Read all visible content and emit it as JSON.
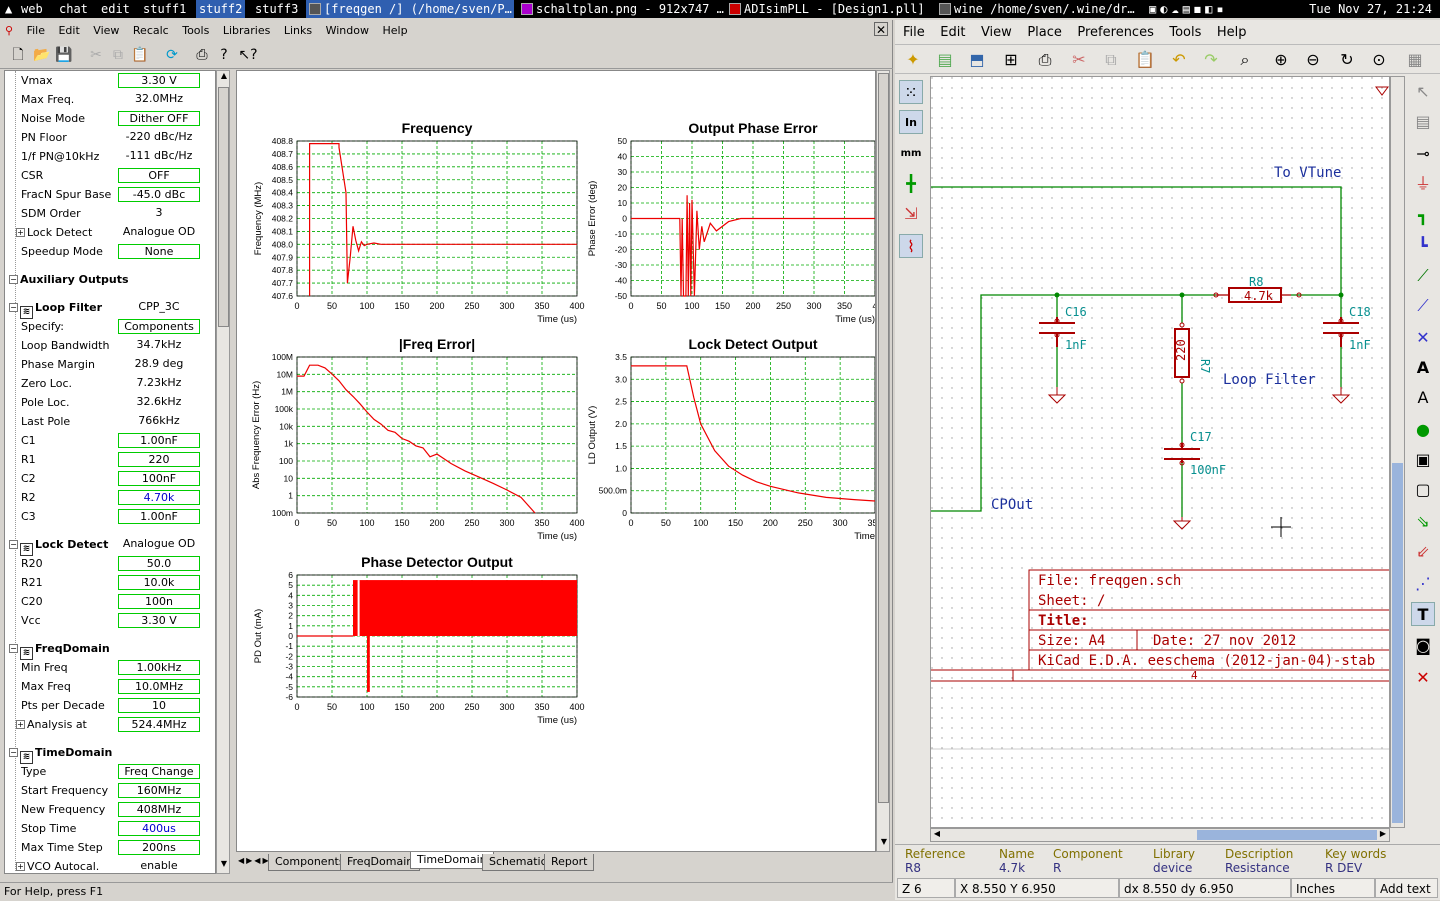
{
  "taskbar": {
    "items": [
      "web",
      "chat",
      "edit",
      "stuff1",
      "stuff2",
      "stuff3"
    ],
    "windows": [
      "[freqgen /] (/home/sven/P…",
      "schaltplan.png - 912x747 …",
      "ADIsimPLL - [Design1.pll]",
      "wine /home/sven/.wine/dr…"
    ],
    "clock": "Tue Nov 27, 21:24"
  },
  "adi": {
    "menu": [
      "File",
      "Edit",
      "View",
      "Recalc",
      "Tools",
      "Libraries",
      "Links",
      "Window",
      "Help"
    ],
    "tree": [
      {
        "label": "Vmax",
        "value": "3.30 V",
        "box": true
      },
      {
        "label": "Max Freq.",
        "value": "32.0MHz"
      },
      {
        "label": "Noise Mode",
        "value": "Dither OFF",
        "box": true
      },
      {
        "label": "PN Floor",
        "value": "-220 dBc/Hz"
      },
      {
        "label": "1/f PN@10kHz",
        "value": "-111 dBc/Hz"
      },
      {
        "label": "CSR",
        "value": "OFF",
        "box": true
      },
      {
        "label": "FracN Spur Base",
        "value": "-45.0 dBc",
        "box": true
      },
      {
        "label": "SDM Order",
        "value": "3"
      },
      {
        "label": "Lock Detect",
        "value": "Analogue OD",
        "exp": true
      },
      {
        "label": "Speedup Mode",
        "value": "None",
        "box": true
      },
      {
        "gap": true
      },
      {
        "label": "Auxiliary Outputs",
        "section": true
      },
      {
        "gap": true
      },
      {
        "label": "Loop Filter",
        "value": "CPP_3C",
        "section": true,
        "icon": true
      },
      {
        "label": "Specify:",
        "value": "Components",
        "box": true
      },
      {
        "label": "Loop Bandwidth",
        "value": "34.7kHz"
      },
      {
        "label": "Phase Margin",
        "value": "28.9 deg"
      },
      {
        "label": "Zero Loc.",
        "value": "7.23kHz"
      },
      {
        "label": "Pole Loc.",
        "value": "32.6kHz"
      },
      {
        "label": "Last Pole",
        "value": "766kHz"
      },
      {
        "label": "C1",
        "value": "1.00nF",
        "box": true
      },
      {
        "label": "R1",
        "value": "220",
        "box": true
      },
      {
        "label": "C2",
        "value": "100nF",
        "box": true
      },
      {
        "label": "R2",
        "value": "4.70k",
        "box": true,
        "blue": true
      },
      {
        "label": "C3",
        "value": "1.00nF",
        "box": true
      },
      {
        "gap": true
      },
      {
        "label": "Lock Detect",
        "value": "Analogue OD",
        "section": true,
        "icon": true
      },
      {
        "label": "R20",
        "value": "50.0",
        "box": true
      },
      {
        "label": "R21",
        "value": "10.0k",
        "box": true
      },
      {
        "label": "C20",
        "value": "100n",
        "box": true
      },
      {
        "label": "Vcc",
        "value": "3.30 V",
        "box": true
      },
      {
        "gap": true
      },
      {
        "label": "FreqDomain",
        "section": true,
        "icon": true
      },
      {
        "label": "Min Freq",
        "value": "1.00kHz",
        "box": true
      },
      {
        "label": "Max Freq",
        "value": "10.0MHz",
        "box": true
      },
      {
        "label": "Pts per Decade",
        "value": "10",
        "box": true
      },
      {
        "label": "Analysis at",
        "value": "524.4MHz",
        "box": true,
        "exp": true
      },
      {
        "gap": true
      },
      {
        "label": "TimeDomain",
        "section": true,
        "icon": true
      },
      {
        "label": "Type",
        "value": "Freq Change",
        "box": true
      },
      {
        "label": "Start Frequency",
        "value": "160MHz",
        "box": true
      },
      {
        "label": "New Frequency",
        "value": "408MHz",
        "box": true
      },
      {
        "label": "Stop Time",
        "value": "400us",
        "box": true,
        "blue": true
      },
      {
        "label": "Max Time Step",
        "value": "200ns",
        "box": true
      },
      {
        "label": "VCO Autocal.",
        "value": "enable",
        "exp": true
      }
    ],
    "tabs": [
      "Components",
      "FreqDomain",
      "TimeDomain",
      "Schematic",
      "Report"
    ],
    "active_tab": "TimeDomain",
    "status": "For Help, press F1"
  },
  "chart_data": [
    {
      "type": "line",
      "title": "Frequency",
      "xlabel": "Time (us)",
      "ylabel": "Frequency (MHz)",
      "xlim": [
        0,
        400
      ],
      "ylim": [
        407.6,
        408.8
      ],
      "xticks": [
        "0",
        "50",
        "100",
        "150",
        "200",
        "250",
        "300",
        "350",
        "400"
      ],
      "yticks": [
        "407.6",
        "407.7",
        "407.8",
        "407.9",
        "408.0",
        "408.1",
        "408.2",
        "408.3",
        "408.4",
        "408.5",
        "408.6",
        "408.7",
        "408.8"
      ],
      "x": [
        18,
        18,
        60,
        60,
        70,
        72,
        76,
        80,
        84,
        88,
        92,
        96,
        100,
        110,
        120,
        140,
        160,
        200,
        400
      ],
      "y": [
        407.6,
        408.78,
        408.78,
        408.75,
        408.4,
        407.7,
        407.9,
        408.14,
        408.03,
        407.95,
        408.02,
        407.99,
        408.0,
        408.01,
        408.0,
        408.0,
        408.0,
        408.0,
        408.0
      ]
    },
    {
      "type": "line",
      "title": "Output Phase Error",
      "xlabel": "Time (us)",
      "ylabel": "Phase Error (deg)",
      "xlim": [
        0,
        400
      ],
      "ylim": [
        -50,
        50
      ],
      "xticks": [
        "0",
        "50",
        "100",
        "150",
        "200",
        "250",
        "300",
        "350",
        "4"
      ],
      "yticks": [
        "-50",
        "-40",
        "-30",
        "-20",
        "-10",
        "0",
        "10",
        "20",
        "30",
        "40",
        "50"
      ],
      "x": [
        0,
        80,
        82,
        84,
        86,
        90,
        92,
        94,
        96,
        98,
        100,
        104,
        108,
        112,
        116,
        120,
        130,
        140,
        160,
        180,
        200,
        400
      ],
      "y": [
        0,
        0,
        -50,
        0,
        -50,
        -50,
        15,
        -50,
        10,
        -50,
        12,
        -50,
        5,
        -20,
        -5,
        -15,
        -3,
        -8,
        -2,
        0,
        0,
        0
      ]
    },
    {
      "type": "line",
      "title": "|Freq Error|",
      "xlabel": "Time (us)",
      "ylabel": "Abs Frequency Error (Hz)",
      "xlim": [
        0,
        400
      ],
      "ylim": [
        0.01,
        100000000
      ],
      "yscale": "log",
      "xticks": [
        "0",
        "50",
        "100",
        "150",
        "200",
        "250",
        "300",
        "350",
        "400"
      ],
      "yticks": [
        "100m",
        "1",
        "10",
        "100",
        "1k",
        "10k",
        "100k",
        "1M",
        "10M",
        "100M"
      ],
      "x": [
        0,
        10,
        18,
        30,
        40,
        50,
        60,
        70,
        80,
        90,
        100,
        110,
        120,
        130,
        140,
        150,
        160,
        170,
        180,
        190,
        200,
        210,
        220,
        240,
        260,
        280,
        300,
        320,
        340
      ],
      "y": [
        6000000,
        6000000,
        30000000,
        30000000,
        20000000,
        8000000,
        3000000,
        800000,
        300000,
        100000,
        30000,
        10000,
        5000,
        2000,
        1500,
        600,
        400,
        200,
        150,
        40,
        60,
        30,
        15,
        5,
        2,
        0.8,
        0.3,
        0.1,
        0.01
      ]
    },
    {
      "type": "line",
      "title": "Lock Detect Output",
      "xlabel": "Time",
      "ylabel": "LD Output (V)",
      "xlim": [
        0,
        350
      ],
      "ylim": [
        0,
        3.5
      ],
      "xticks": [
        "0",
        "50",
        "100",
        "150",
        "200",
        "250",
        "300",
        "350"
      ],
      "yticks": [
        "0",
        "500.0m",
        "1.0",
        "1.5",
        "2.0",
        "2.5",
        "3.0",
        "3.5"
      ],
      "x": [
        0,
        80,
        90,
        100,
        120,
        140,
        160,
        180,
        200,
        240,
        280,
        320,
        350
      ],
      "y": [
        3.3,
        3.3,
        2.6,
        2.0,
        1.4,
        1.05,
        0.85,
        0.7,
        0.6,
        0.45,
        0.35,
        0.3,
        0.27
      ]
    },
    {
      "type": "bar",
      "title": "Phase Detector Output",
      "xlabel": "Time (us)",
      "ylabel": "PD Out (mA)",
      "xlim": [
        0,
        400
      ],
      "ylim": [
        -6,
        6
      ],
      "xticks": [
        "0",
        "50",
        "100",
        "150",
        "200",
        "250",
        "300",
        "350",
        "400"
      ],
      "yticks": [
        "-6",
        "-5",
        "-4",
        "-3",
        "-2",
        "-1",
        "0",
        "1",
        "2",
        "3",
        "4",
        "5",
        "6"
      ],
      "segments": [
        {
          "x0": 80,
          "x1": 400,
          "lo": 0,
          "hi": 5.5
        },
        {
          "x0": 100,
          "x1": 104,
          "lo": -5.5,
          "hi": 0
        }
      ]
    }
  ],
  "kicad": {
    "menu": [
      "File",
      "Edit",
      "View",
      "Place",
      "Preferences",
      "Tools",
      "Help"
    ],
    "labels": {
      "vtune": "To VTune",
      "loop": "Loop Filter",
      "cpout": "CPOut",
      "r8ref": "R8",
      "r8val": "4.7k",
      "c16ref": "C16",
      "c16val": "1nF",
      "r7ref": "R7",
      "r7val": "220",
      "c17ref": "C17",
      "c17val": "100nF",
      "c18ref": "C18",
      "c18val": "1nF"
    },
    "titleblock": {
      "file": "File: freqgen.sch",
      "sheet": "Sheet: /",
      "title": "Title:",
      "size": "Size: A4",
      "date": "Date: 27 nov 2012",
      "app": "KiCad E.D.A.  eeschema (2012-jan-04)-stab",
      "rev": "4"
    },
    "info": [
      {
        "h": "Reference",
        "v": "R8"
      },
      {
        "h": "Name",
        "v": "4.7k"
      },
      {
        "h": "Component",
        "v": "R"
      },
      {
        "h": "Library",
        "v": "device"
      },
      {
        "h": "Description",
        "v": "Resistance"
      },
      {
        "h": "Key words",
        "v": "R DEV"
      }
    ],
    "status": {
      "zoom": "Z 6",
      "pos": "X 8.550  Y 6.950",
      "delta": "dx 8.550  dy 6.950",
      "units": "Inches",
      "mode": "Add text"
    }
  }
}
